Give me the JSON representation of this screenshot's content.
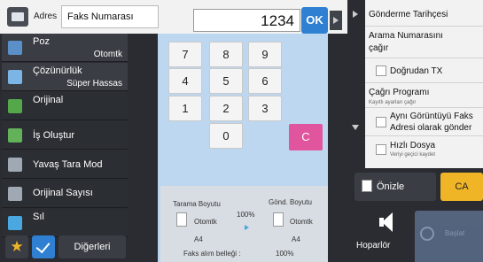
{
  "header": {
    "address_label": "Adres",
    "fax_number_field": "Faks Numarası",
    "number_display": "1234",
    "ok_label": "OK"
  },
  "left_menu": {
    "items": [
      {
        "label": "Poz",
        "value": "Otomtk",
        "icon": "exposure-icon",
        "icon_color": "#5b8fc7"
      },
      {
        "label": "Çözünürlük",
        "value": "Süper Hassas",
        "icon": "resolution-icon",
        "icon_color": "#7bb5e5"
      },
      {
        "label": "Orijinal",
        "value": "",
        "icon": "original-icon",
        "icon_color": "#55a84a"
      },
      {
        "label": "İş Oluştur",
        "value": "",
        "icon": "job-build-icon",
        "icon_color": "#63b25a"
      },
      {
        "label": "Yavaş Tara Mod",
        "value": "",
        "icon": "slow-scan-icon",
        "icon_color": "#a0a8b3"
      },
      {
        "label": "Orijinal Sayısı",
        "value": "",
        "icon": "original-count-icon",
        "icon_color": "#a0a8b3"
      },
      {
        "label": "Sıl",
        "value": "",
        "icon": "erase-icon",
        "icon_color": "#4aa7e0"
      }
    ],
    "others_label": "Diğerleri"
  },
  "keypad": {
    "keys": [
      "7",
      "8",
      "9",
      "4",
      "5",
      "6",
      "1",
      "2",
      "3",
      "0"
    ],
    "clear_label": "C"
  },
  "scan_info": {
    "scan_size_label": "Tarama Boyutu",
    "send_size_label": "Gönd. Boyutu",
    "scan_mode": "Otomtk",
    "send_mode": "Otomtk",
    "ratio": "100%",
    "scan_paper": "A4",
    "send_paper": "A4",
    "memory_label": "Faks alım belleği :",
    "memory_value": "100%"
  },
  "right_panel": {
    "send_history": "Gönderme Tarihçesi",
    "call_number_line1": "Arama Numarasını",
    "call_number_line2": "çağır",
    "direct_tx": "Doğrudan TX",
    "call_program": "Çağrı Programı",
    "call_program_sub": "Kayıtlı ayarları çağır",
    "same_image_line1": "Aynı Görüntüyü Faks",
    "same_image_line2": "Adresi olarak gönder",
    "quick_file": "Hızlı Dosya",
    "quick_file_sub": "Veriyi geçici kaydet"
  },
  "actions": {
    "preview_label": "Önizle",
    "ca_label": "CA",
    "speaker_label": "Hoparlör",
    "start_label": "Başlat"
  },
  "colors": {
    "ok_blue": "#2f7fd2",
    "clear_pink": "#e0559d",
    "ca_yellow": "#f0b526",
    "keypad_background": "#bcd7ef"
  }
}
